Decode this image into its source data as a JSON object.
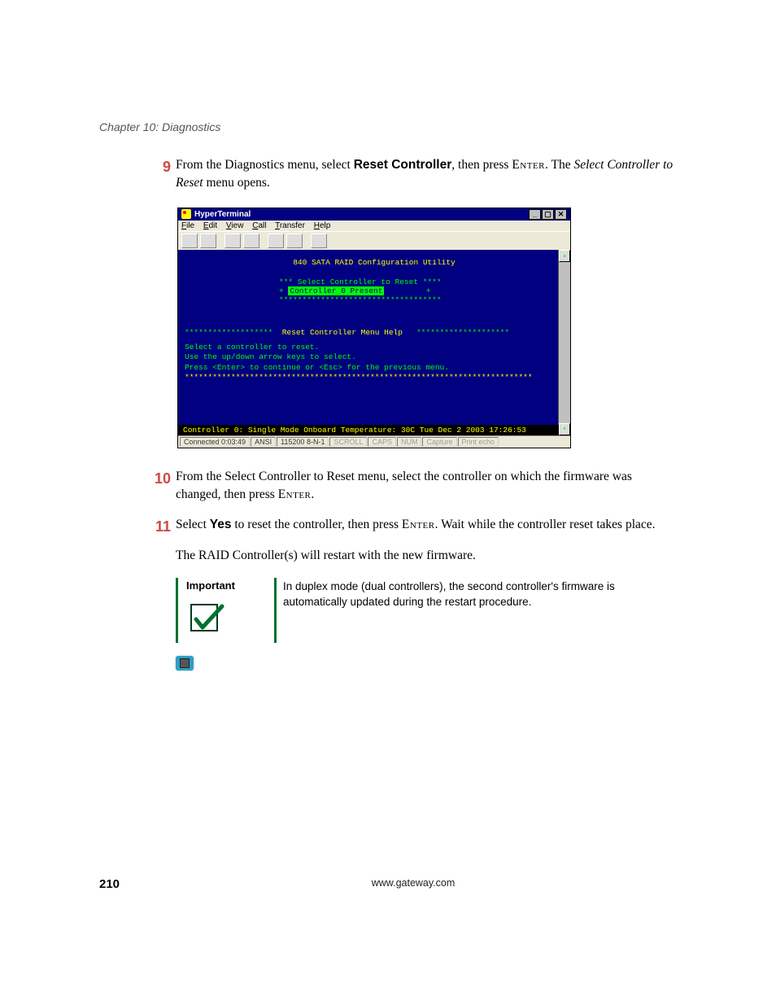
{
  "header": {
    "chapter": "Chapter 10: Diagnostics"
  },
  "steps": {
    "s9": {
      "num": "9",
      "pre": "From the Diagnostics menu, select ",
      "bold1": "Reset Controller",
      "mid1": ", then press ",
      "enter": "Enter",
      "mid2": ". The ",
      "italic": "Select Controller to Reset",
      "post": " menu opens."
    },
    "s10": {
      "num": "10",
      "pre": "From the Select Controller to Reset menu, select the controller on which the firmware was changed, then press ",
      "enter": "Enter",
      "post": "."
    },
    "s11": {
      "num": "11",
      "pre": "Select ",
      "yes": "Yes",
      "mid1": " to reset the controller, then press ",
      "enter": "Enter",
      "post": ". Wait while the controller reset takes place."
    }
  },
  "restart_line": "The RAID Controller(s) will restart with the new firmware.",
  "important": {
    "label": "Important",
    "text": "In duplex mode (dual controllers), the second controller's firmware is automatically updated during the restart procedure."
  },
  "ht": {
    "title": "HyperTerminal",
    "menu": {
      "file": "File",
      "edit": "Edit",
      "view": "View",
      "call": "Call",
      "transfer": "Transfer",
      "help": "Help"
    },
    "term": {
      "title": "840 SATA RAID Configuration Utility",
      "stars_top": "*** Select Controller to Reset ****",
      "option_plus": "+",
      "option": "Controller 0 Present",
      "stars_bot": "***********************************",
      "help_stars_l": "*******************",
      "help_title": "Reset Controller Menu Help",
      "help_stars_r": "********************",
      "help1": "Select a controller to reset.",
      "help2": "Use the up/down arrow keys to select.",
      "help3": "Press <Enter> to continue or <Esc> for the previous menu.",
      "help_stars_full": "***************************************************************************",
      "footer": "Controller 0:  Single Mode    Onboard Temperature: 30C     Tue Dec 2 2003  17:26:53"
    },
    "status": {
      "conn": "Connected 0:03:49",
      "emul": "ANSI",
      "baud": "115200 8-N-1",
      "scroll": "SCROLL",
      "caps": "CAPS",
      "num": "NUM",
      "capture": "Capture",
      "echo": "Print echo"
    }
  },
  "footer": {
    "page": "210",
    "url": "www.gateway.com"
  }
}
